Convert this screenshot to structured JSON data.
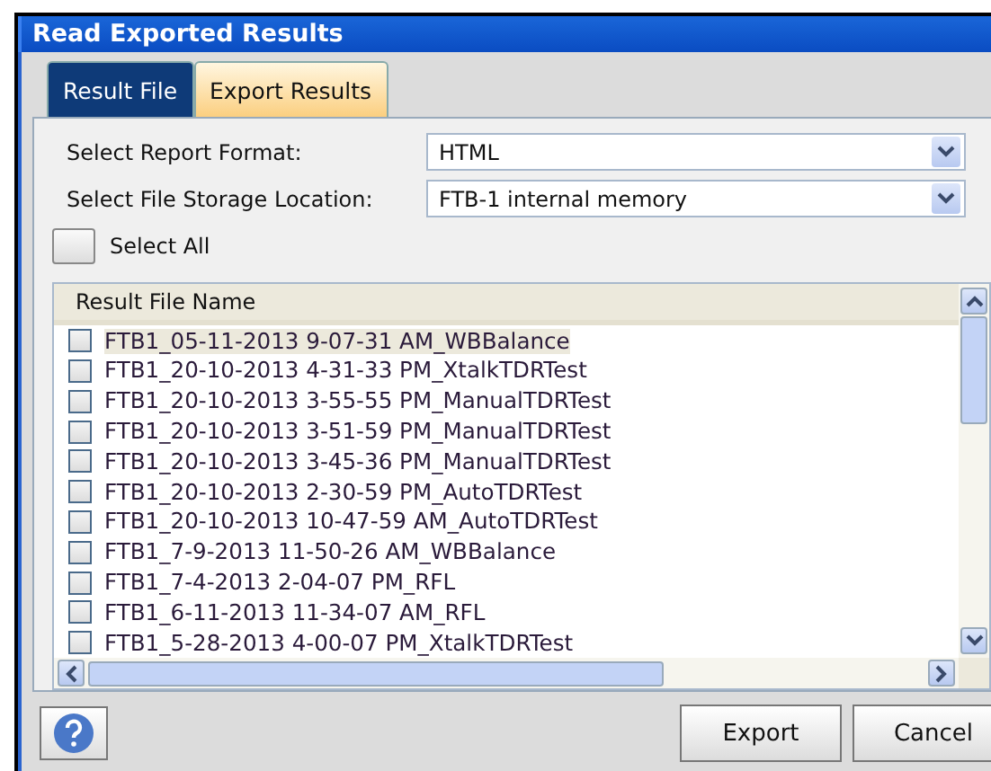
{
  "window": {
    "title": "Read Exported Results"
  },
  "tabs": [
    {
      "label": "Result File",
      "selected": true
    },
    {
      "label": "Export Results",
      "selected": false
    }
  ],
  "fields": [
    {
      "label": "Select Report Format:",
      "value": "HTML"
    },
    {
      "label": "Select File Storage Location:",
      "value": "FTB-1 internal memory"
    }
  ],
  "select_all": {
    "label": "Select All",
    "checked": false
  },
  "list": {
    "column": "Result File Name",
    "rows": [
      {
        "name": "FTB1_05-11-2013 9-07-31 AM_WBBalance",
        "checked": false,
        "selected": true
      },
      {
        "name": "FTB1_20-10-2013 4-31-33 PM_XtalkTDRTest",
        "checked": false,
        "selected": false
      },
      {
        "name": "FTB1_20-10-2013 3-55-55 PM_ManualTDRTest",
        "checked": false,
        "selected": false
      },
      {
        "name": "FTB1_20-10-2013 3-51-59 PM_ManualTDRTest",
        "checked": false,
        "selected": false
      },
      {
        "name": "FTB1_20-10-2013 3-45-36 PM_ManualTDRTest",
        "checked": false,
        "selected": false
      },
      {
        "name": "FTB1_20-10-2013 2-30-59 PM_AutoTDRTest",
        "checked": false,
        "selected": false
      },
      {
        "name": "FTB1_20-10-2013 10-47-59 AM_AutoTDRTest",
        "checked": false,
        "selected": false
      },
      {
        "name": "FTB1_7-9-2013 11-50-26 AM_WBBalance",
        "checked": false,
        "selected": false
      },
      {
        "name": "FTB1_7-4-2013 2-04-07 PM_RFL",
        "checked": false,
        "selected": false
      },
      {
        "name": "FTB1_6-11-2013 11-34-07 AM_RFL",
        "checked": false,
        "selected": false
      },
      {
        "name": "FTB1_5-28-2013 4-00-07 PM_XtalkTDRTest",
        "checked": false,
        "selected": false
      }
    ]
  },
  "buttons": [
    "Export",
    "Cancel"
  ]
}
